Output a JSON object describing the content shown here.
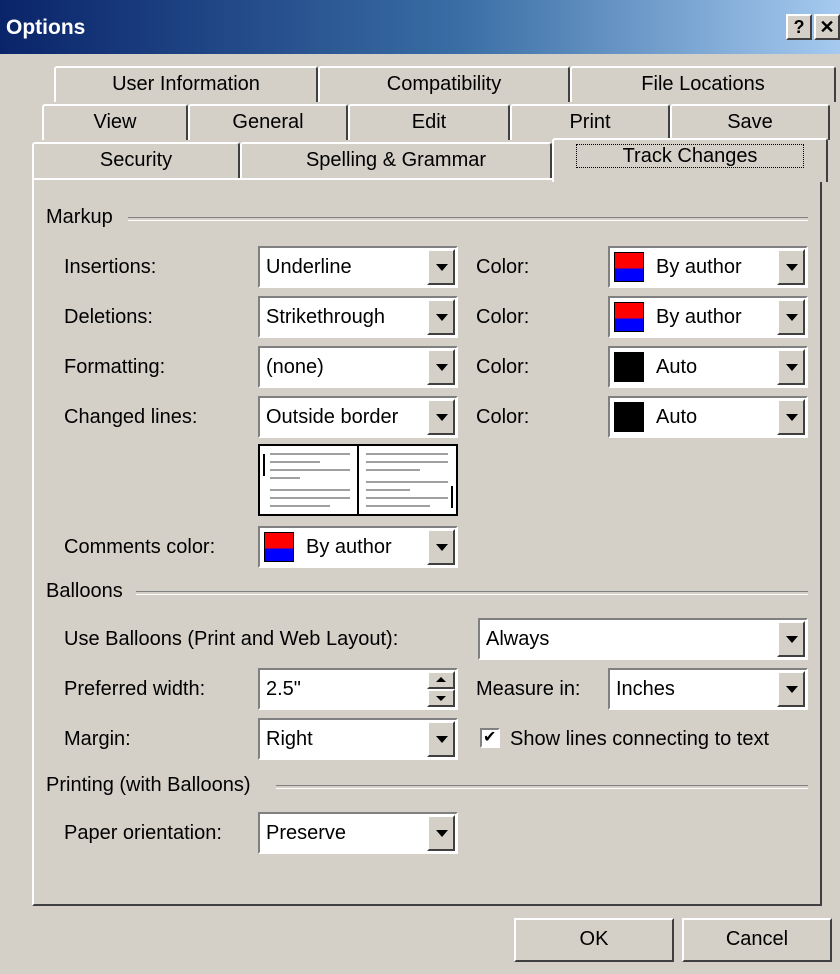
{
  "window": {
    "title": "Options"
  },
  "tabs": {
    "row1": [
      "User Information",
      "Compatibility",
      "File Locations"
    ],
    "row2": [
      "View",
      "General",
      "Edit",
      "Print",
      "Save"
    ],
    "row3": [
      "Security",
      "Spelling & Grammar",
      "Track Changes"
    ]
  },
  "markup": {
    "group_label": "Markup",
    "insertions": {
      "label": "Insertions:",
      "value": "Underline",
      "color_label": "Color:",
      "color_value": "By author"
    },
    "deletions": {
      "label": "Deletions:",
      "value": "Strikethrough",
      "color_label": "Color:",
      "color_value": "By author"
    },
    "formatting": {
      "label": "Formatting:",
      "value": "(none)",
      "color_label": "Color:",
      "color_value": "Auto"
    },
    "changed_lines": {
      "label": "Changed lines:",
      "value": "Outside border",
      "color_label": "Color:",
      "color_value": "Auto"
    },
    "comments": {
      "label": "Comments color:",
      "value": "By author"
    }
  },
  "balloons": {
    "group_label": "Balloons",
    "use_label": "Use Balloons (Print and Web Layout):",
    "use_value": "Always",
    "width_label": "Preferred width:",
    "width_value": "2.5\"",
    "measure_label": "Measure in:",
    "measure_value": "Inches",
    "margin_label": "Margin:",
    "margin_value": "Right",
    "show_lines_label": "Show lines connecting to text",
    "show_lines_checked": true
  },
  "printing": {
    "group_label": "Printing (with Balloons)",
    "orientation_label": "Paper orientation:",
    "orientation_value": "Preserve"
  },
  "buttons": {
    "ok": "OK",
    "cancel": "Cancel"
  },
  "colors": {
    "author_top": "#ff0000",
    "author_bottom": "#0000ff",
    "auto": "#000000",
    "titlebar": "#0a246a"
  }
}
